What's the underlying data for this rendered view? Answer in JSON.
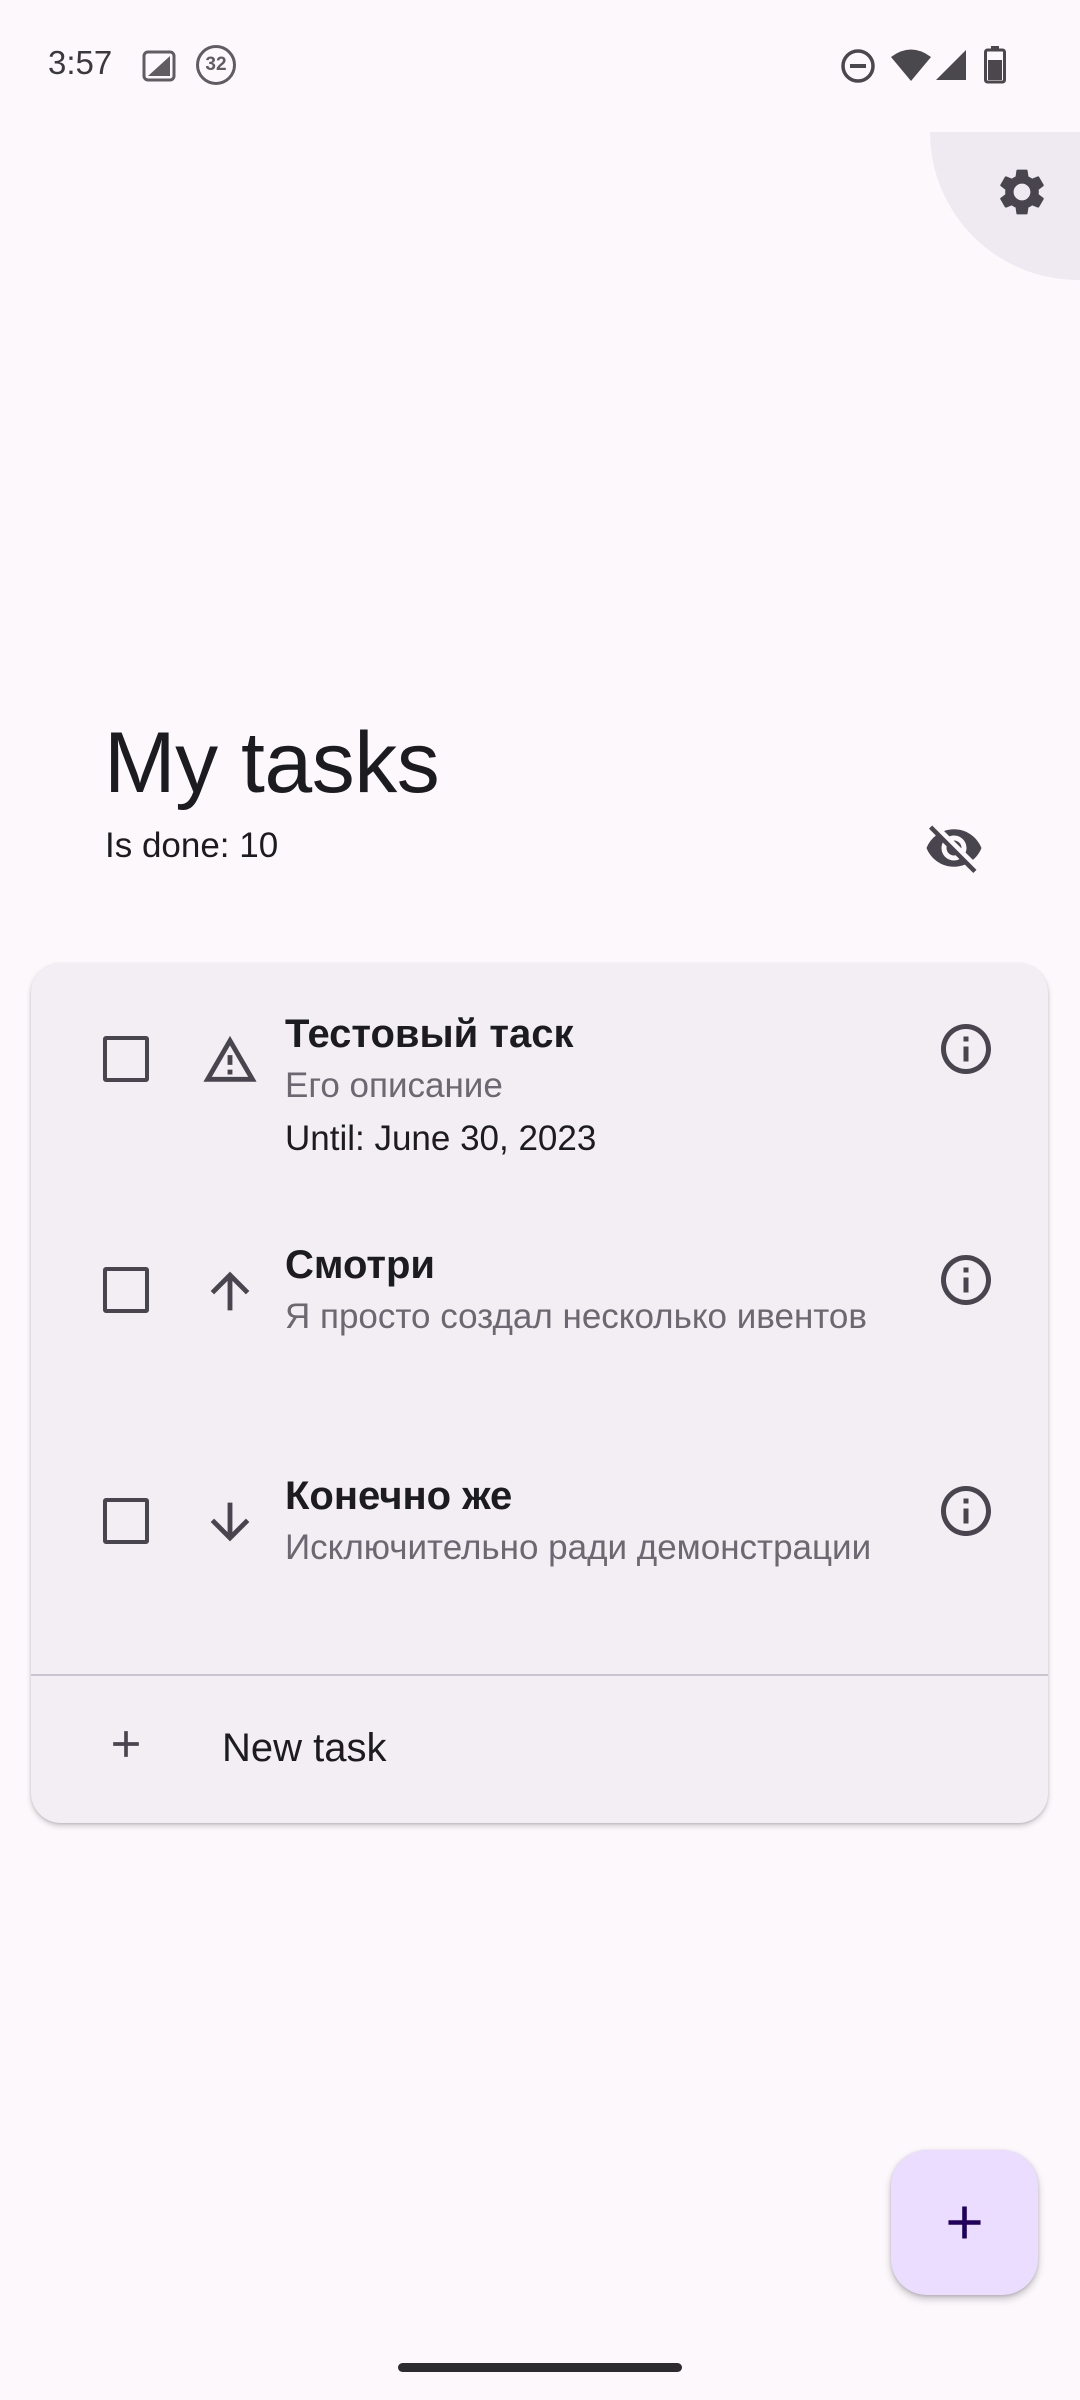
{
  "status_bar": {
    "time": "3:57",
    "badge": "32",
    "icons": [
      "photo-icon",
      "badge-icon",
      "dnd-icon",
      "wifi-icon",
      "cell-signal-icon",
      "battery-icon"
    ]
  },
  "header": {
    "title": "My tasks",
    "done_count": "Is done: 10"
  },
  "tasks": [
    {
      "title": "Тестовый таск",
      "description": "Его описание",
      "until": "Until: June 30, 2023",
      "priority_icon": "warning-icon",
      "checked": false
    },
    {
      "title": "Смотри",
      "description": "Я просто создал несколько ивентов",
      "priority_icon": "arrow-up-icon",
      "checked": false
    },
    {
      "title": "Конечно же",
      "description": "Исключительно ради демонстрации",
      "priority_icon": "arrow-down-icon",
      "checked": false
    }
  ],
  "new_task_label": "New task",
  "colors": {
    "background": "#fdf8fc",
    "card": "#f2eef4",
    "fab": "#eaddff",
    "fab_icon": "#21005d",
    "secondary_text": "#6c6770"
  }
}
